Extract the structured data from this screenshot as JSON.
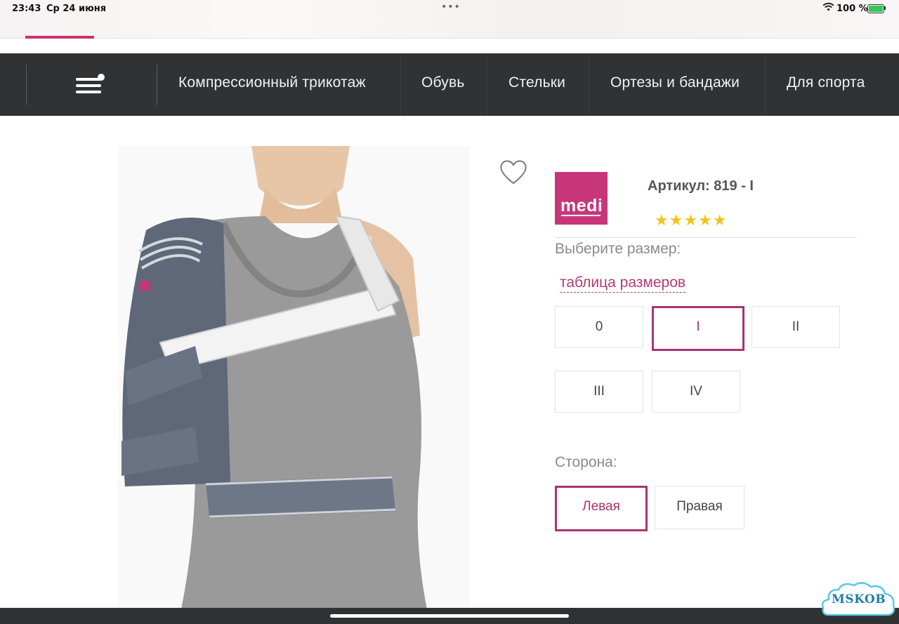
{
  "status_bar": {
    "time": "23:43",
    "date": "Ср 24 июня",
    "dots": "•••",
    "battery": "100 %"
  },
  "nav": {
    "items": [
      "Компрессионный трикотаж",
      "Обувь",
      "Стельки",
      "Ортезы и бандажи",
      "Для спорта"
    ]
  },
  "brand": {
    "logo_text": "medi",
    "color": "#c7367a"
  },
  "product": {
    "sku": "Артикул: 819 - I",
    "stars": "★★★★★",
    "rating": 5
  },
  "size": {
    "title": "Выберите размер:",
    "table_link": "таблица размеров",
    "options": [
      "0",
      "I",
      "II",
      "III",
      "IV"
    ],
    "selected": "I"
  },
  "side": {
    "title": "Сторона:",
    "options": [
      "Левая",
      "Правая"
    ],
    "selected": "Левая"
  },
  "accent_color": "#a8346f",
  "watermark": "MSKOB"
}
